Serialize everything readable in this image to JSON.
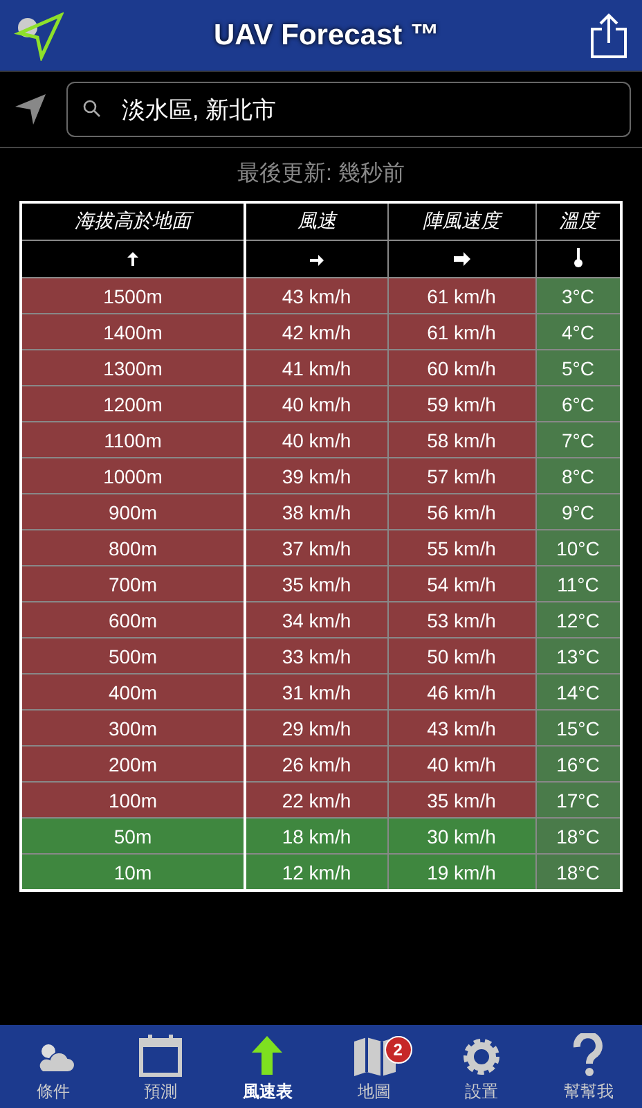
{
  "header": {
    "title": "UAV Forecast ™"
  },
  "search": {
    "value": "淡水區, 新北市"
  },
  "last_updated": "最後更新: 幾秒前",
  "table": {
    "columns": [
      "海拔高於地面",
      "風速",
      "陣風速度",
      "溫度"
    ],
    "rows": [
      {
        "altitude": "1500m",
        "wind": "43 km/h",
        "gust": "61 km/h",
        "temp": "3°C",
        "safe": false
      },
      {
        "altitude": "1400m",
        "wind": "42 km/h",
        "gust": "61 km/h",
        "temp": "4°C",
        "safe": false
      },
      {
        "altitude": "1300m",
        "wind": "41 km/h",
        "gust": "60 km/h",
        "temp": "5°C",
        "safe": false
      },
      {
        "altitude": "1200m",
        "wind": "40 km/h",
        "gust": "59 km/h",
        "temp": "6°C",
        "safe": false
      },
      {
        "altitude": "1100m",
        "wind": "40 km/h",
        "gust": "58 km/h",
        "temp": "7°C",
        "safe": false
      },
      {
        "altitude": "1000m",
        "wind": "39 km/h",
        "gust": "57 km/h",
        "temp": "8°C",
        "safe": false
      },
      {
        "altitude": "900m",
        "wind": "38 km/h",
        "gust": "56 km/h",
        "temp": "9°C",
        "safe": false
      },
      {
        "altitude": "800m",
        "wind": "37 km/h",
        "gust": "55 km/h",
        "temp": "10°C",
        "safe": false
      },
      {
        "altitude": "700m",
        "wind": "35 km/h",
        "gust": "54 km/h",
        "temp": "11°C",
        "safe": false
      },
      {
        "altitude": "600m",
        "wind": "34 km/h",
        "gust": "53 km/h",
        "temp": "12°C",
        "safe": false
      },
      {
        "altitude": "500m",
        "wind": "33 km/h",
        "gust": "50 km/h",
        "temp": "13°C",
        "safe": false
      },
      {
        "altitude": "400m",
        "wind": "31 km/h",
        "gust": "46 km/h",
        "temp": "14°C",
        "safe": false
      },
      {
        "altitude": "300m",
        "wind": "29 km/h",
        "gust": "43 km/h",
        "temp": "15°C",
        "safe": false
      },
      {
        "altitude": "200m",
        "wind": "26 km/h",
        "gust": "40 km/h",
        "temp": "16°C",
        "safe": false
      },
      {
        "altitude": "100m",
        "wind": "22 km/h",
        "gust": "35 km/h",
        "temp": "17°C",
        "safe": false
      },
      {
        "altitude": "50m",
        "wind": "18 km/h",
        "gust": "30 km/h",
        "temp": "18°C",
        "safe": true
      },
      {
        "altitude": "10m",
        "wind": "12 km/h",
        "gust": "19 km/h",
        "temp": "18°C",
        "safe": true
      }
    ]
  },
  "tab_bar": [
    {
      "label": "條件",
      "kind": "conditions",
      "selected": false
    },
    {
      "label": "預測",
      "kind": "forecast",
      "selected": false
    },
    {
      "label": "風速表",
      "kind": "wind",
      "selected": true
    },
    {
      "label": "地圖",
      "kind": "map",
      "selected": false,
      "badge": "2"
    },
    {
      "label": "設置",
      "kind": "settings",
      "selected": false
    },
    {
      "label": "幫幫我",
      "kind": "help",
      "selected": false
    }
  ]
}
